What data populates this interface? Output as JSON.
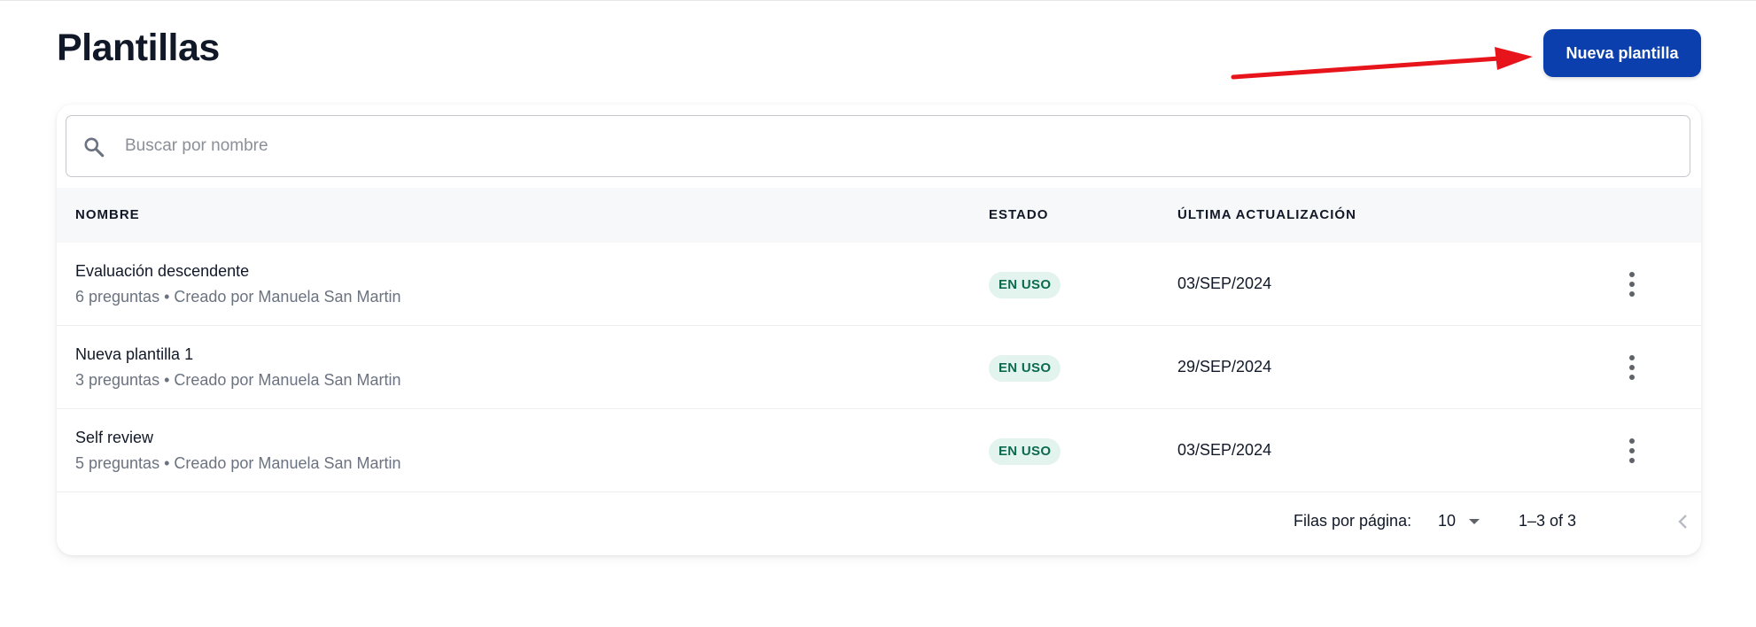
{
  "header": {
    "title": "Plantillas",
    "new_button_label": "Nueva plantilla"
  },
  "colors": {
    "primary": "#0b3fae",
    "annotation_arrow": "#e8141b",
    "badge_bg": "#e3f4ef",
    "badge_text": "#0c6b4f"
  },
  "search": {
    "placeholder": "Buscar por nombre",
    "value": "",
    "icon": "search-icon"
  },
  "table": {
    "columns": [
      "NOMBRE",
      "ESTADO",
      "ÚLTIMA ACTUALIZACIÓN"
    ],
    "rows": [
      {
        "name": "Evaluación descendente",
        "subtitle": "6 preguntas • Creado por Manuela San Martin",
        "status": "EN USO",
        "updated": "03/SEP/2024",
        "menu_icon": "more-vert-icon"
      },
      {
        "name": "Nueva plantilla 1",
        "subtitle": "3 preguntas • Creado por Manuela San Martin",
        "status": "EN USO",
        "updated": "29/SEP/2024",
        "menu_icon": "more-vert-icon"
      },
      {
        "name": "Self review",
        "subtitle": "5 preguntas • Creado por Manuela San Martin",
        "status": "EN USO",
        "updated": "03/SEP/2024",
        "menu_icon": "more-vert-icon"
      }
    ]
  },
  "pagination": {
    "rows_per_page_label": "Filas por página:",
    "rows_per_page_value": "10",
    "range_text": "1–3 of 3",
    "prev_icon": "chevron-left-icon",
    "next_icon": "chevron-right-icon"
  }
}
